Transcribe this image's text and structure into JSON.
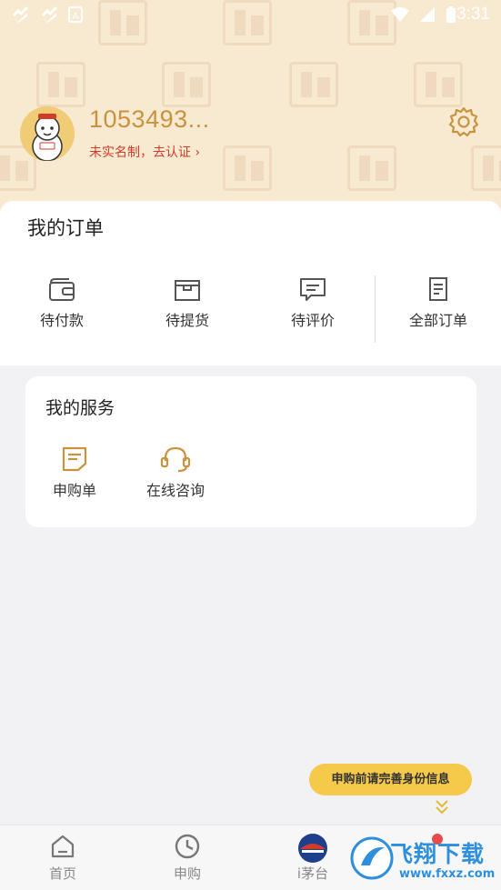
{
  "status_bar": {
    "time": "3:31",
    "icons": [
      "notification-icon",
      "notification-icon",
      "a-icon",
      "wifi-icon",
      "battery-icon"
    ]
  },
  "profile": {
    "username": "1053493...",
    "verify_text": "未实名制，去认证",
    "verify_chevron": "›"
  },
  "orders": {
    "title": "我的订单",
    "items": [
      {
        "label": "待付款",
        "icon": "wallet-icon"
      },
      {
        "label": "待提货",
        "icon": "box-icon"
      },
      {
        "label": "待评价",
        "icon": "comment-icon"
      },
      {
        "label": "全部订单",
        "icon": "document-icon"
      }
    ]
  },
  "services": {
    "title": "我的服务",
    "items": [
      {
        "label": "申购单",
        "icon": "form-icon"
      },
      {
        "label": "在线咨询",
        "icon": "headset-icon"
      }
    ]
  },
  "tip": {
    "text": "申购前请完善身份信息"
  },
  "bottom_nav": {
    "items": [
      {
        "label": "首页",
        "icon": "home-icon"
      },
      {
        "label": "申购",
        "icon": "clock-icon"
      },
      {
        "label": "i茅台",
        "icon": "moutai-logo-icon"
      }
    ]
  },
  "watermark": {
    "text": "飞翔下载",
    "sub": "www.fxxz.com"
  },
  "colors": {
    "header_bg": "#f8ead0",
    "accent_gold": "#c8923f",
    "verify_red": "#d23b2a",
    "tip_yellow": "#f5c94a"
  }
}
